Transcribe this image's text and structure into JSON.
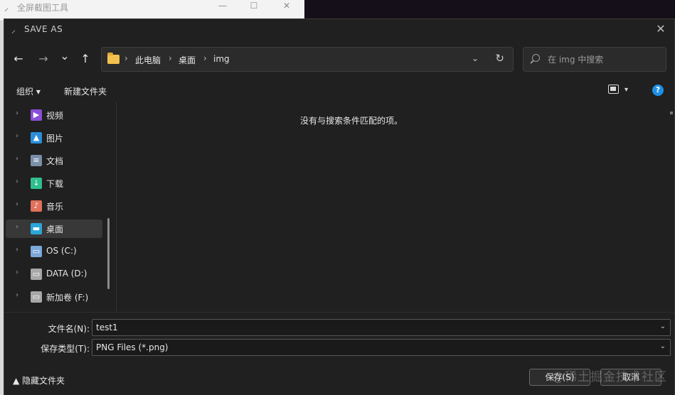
{
  "background_window": {
    "title": "全屏截图工具",
    "minimize": "—",
    "maximize": "☐",
    "close": "✕"
  },
  "dialog": {
    "title": "SAVE AS",
    "close": "✕"
  },
  "nav": {
    "back": "←",
    "forward": "→",
    "recent": "⌄",
    "up": "↑"
  },
  "address": {
    "crumbs": [
      "此电脑",
      "桌面",
      "img"
    ],
    "separator": "›",
    "dropdown": "⌄",
    "refresh": "↻"
  },
  "search": {
    "placeholder": "在 img 中搜索"
  },
  "toolbar": {
    "organize": "组织 ▾",
    "new_folder": "新建文件夹",
    "view_dropdown": "▾",
    "help": "?"
  },
  "sidebar": {
    "items": [
      {
        "label": "视频",
        "icon": "video-icon",
        "color": "#8a4fd6"
      },
      {
        "label": "图片",
        "icon": "picture-icon",
        "color": "#2a8fd8"
      },
      {
        "label": "文档",
        "icon": "document-icon",
        "color": "#7a8fa8"
      },
      {
        "label": "下载",
        "icon": "download-icon",
        "color": "#2fbf8f"
      },
      {
        "label": "音乐",
        "icon": "music-icon",
        "color": "#e0715b"
      },
      {
        "label": "桌面",
        "icon": "desktop-icon",
        "color": "#2aa6d8"
      },
      {
        "label": "OS (C:)",
        "icon": "drive-c-icon",
        "color": "#7aa8d8"
      },
      {
        "label": "DATA (D:)",
        "icon": "drive-icon",
        "color": "#a8a8a8"
      },
      {
        "label": "新加卷 (F:)",
        "icon": "drive-icon",
        "color": "#a8a8a8"
      }
    ],
    "selected_index": 5,
    "chevron": "›"
  },
  "main": {
    "empty_message": "没有与搜索条件匹配的项。"
  },
  "form": {
    "filename_label": "文件名(N):",
    "filename_value": "test1",
    "filetype_label": "保存类型(T):",
    "filetype_value": "PNG Files (*.png)",
    "dropdown": "⌄"
  },
  "footer": {
    "hide_folders": "▲  隐藏文件夹",
    "save": "保存(S)",
    "cancel": "取消",
    "watermark": "@稀土掘金技术社区"
  }
}
